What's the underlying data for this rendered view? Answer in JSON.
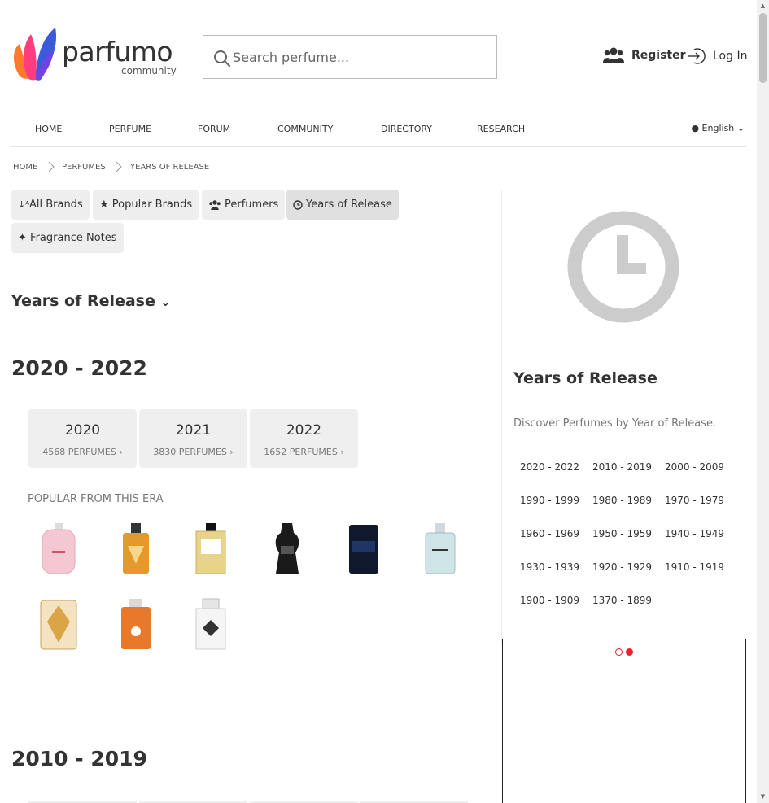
{
  "header": {
    "logo_text": "parfumo",
    "logo_sub": "community",
    "search_placeholder": "Search perfume...",
    "register": "Register",
    "login": "Log In"
  },
  "nav": {
    "items": [
      "HOME",
      "PERFUME",
      "FORUM",
      "COMMUNITY",
      "DIRECTORY",
      "RESEARCH"
    ],
    "language": "English"
  },
  "breadcrumb": [
    "HOME",
    "PERFUMES",
    "YEARS OF RELEASE"
  ],
  "tabs": [
    "All Brands",
    "Popular Brands",
    "Perfumers",
    "Years of Release",
    "Fragrance Notes"
  ],
  "main": {
    "title": "Years of Release",
    "era1": {
      "heading": "2020 - 2022",
      "years": [
        {
          "year": "2020",
          "count": "4568 PERFUMES"
        },
        {
          "year": "2021",
          "count": "3830 PERFUMES"
        },
        {
          "year": "2022",
          "count": "1652 PERFUMES"
        }
      ],
      "popular_label": "POPULAR FROM THIS ERA"
    },
    "era2": {
      "heading": "2010 - 2019"
    }
  },
  "sidebar": {
    "title": "Years of Release",
    "description": "Discover Perfumes by Year of Release.",
    "ranges": [
      "2020 - 2022",
      "2010 - 2019",
      "2000 - 2009",
      "1990 - 1999",
      "1980 - 1989",
      "1970 - 1979",
      "1960 - 1969",
      "1950 - 1959",
      "1940 - 1949",
      "1930 - 1939",
      "1920 - 1929",
      "1910 - 1919",
      "1900 - 1909",
      "1370 - 1899"
    ]
  },
  "colors": {
    "accent": "#e8212f",
    "pill": "#eeeeee",
    "clock": "#cccccc"
  }
}
